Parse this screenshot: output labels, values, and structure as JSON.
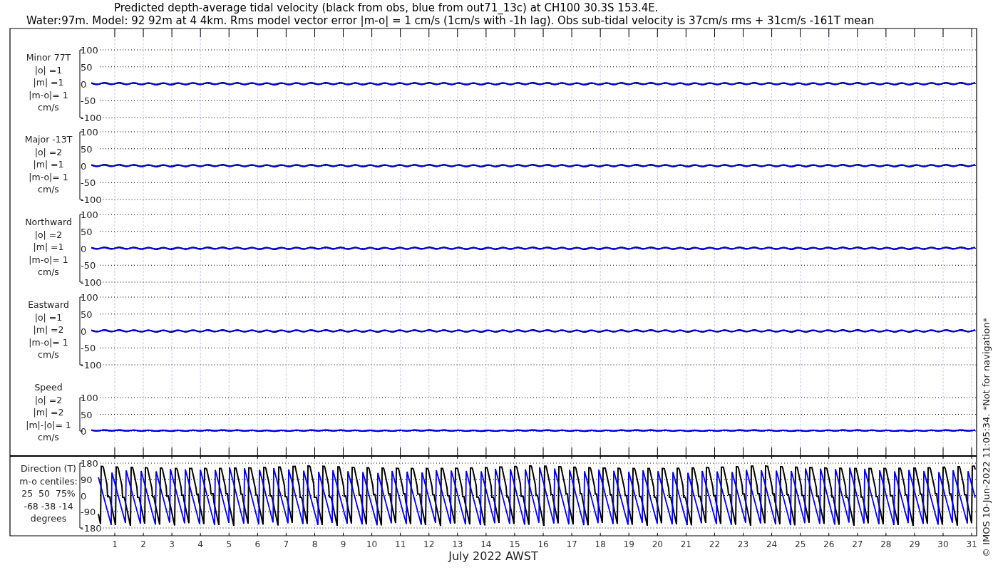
{
  "title_lines": [
    "Predicted depth-average tidal velocity (black from obs, blue from out71_13c) at CH100 30.3S 153.4E.",
    "Water:97m. Model: 92 92m at 4 4km. Rms model vector error |m-o| = 1 cm/s (1cm/s with -1h lag). Obs sub-tidal velocity is 37cm/s rms + 31cm/s -161T mean"
  ],
  "panels": [
    {
      "kind": "velocity",
      "label_lines": [
        "Minor 77T",
        "|o| =1",
        "|m| =1",
        "|m-o|= 1",
        "cm/s"
      ],
      "yticks": [
        "100",
        "50",
        "0",
        "-50",
        "-100"
      ]
    },
    {
      "kind": "velocity",
      "label_lines": [
        "Major -13T",
        "|o| =2",
        "|m| =1",
        "|m-o|= 1",
        "cm/s"
      ],
      "yticks": [
        "100",
        "50",
        "0",
        "-50",
        "-100"
      ]
    },
    {
      "kind": "velocity",
      "label_lines": [
        "Northward",
        "|o| =2",
        "|m| =1",
        "|m-o|= 1",
        "cm/s"
      ],
      "yticks": [
        "100",
        "50",
        "0",
        "-50",
        "-100"
      ]
    },
    {
      "kind": "velocity",
      "label_lines": [
        "Eastward",
        "|o| =1",
        "|m| =2",
        "|m-o|= 1",
        "cm/s"
      ],
      "yticks": [
        "100",
        "50",
        "0",
        "-50",
        "-100"
      ]
    },
    {
      "kind": "speed",
      "label_lines": [
        "Speed",
        "|o| =2",
        "|m| =2",
        "|m|-|o|= 1",
        "cm/s"
      ],
      "yticks": [
        "100",
        "50",
        "0"
      ]
    },
    {
      "kind": "direction",
      "label_lines": [
        "Direction (T)",
        "m-o centiles:",
        "25  50  75%",
        "-68 -38 -14",
        "degrees"
      ],
      "yticks": [
        "180",
        "90",
        "0",
        "-90",
        "-180"
      ]
    }
  ],
  "x_tick_labels": [
    "1",
    "2",
    "3",
    "4",
    "5",
    "6",
    "7",
    "8",
    "9",
    "10",
    "11",
    "12",
    "13",
    "14",
    "15",
    "16",
    "17",
    "18",
    "19",
    "20",
    "21",
    "22",
    "23",
    "24",
    "25",
    "26",
    "27",
    "28",
    "29",
    "30",
    "31"
  ],
  "xlabel": "July 2022 AWST",
  "footer": "© IMOS 10-Jun-2022 11:05:34. *Not for navigation*"
}
